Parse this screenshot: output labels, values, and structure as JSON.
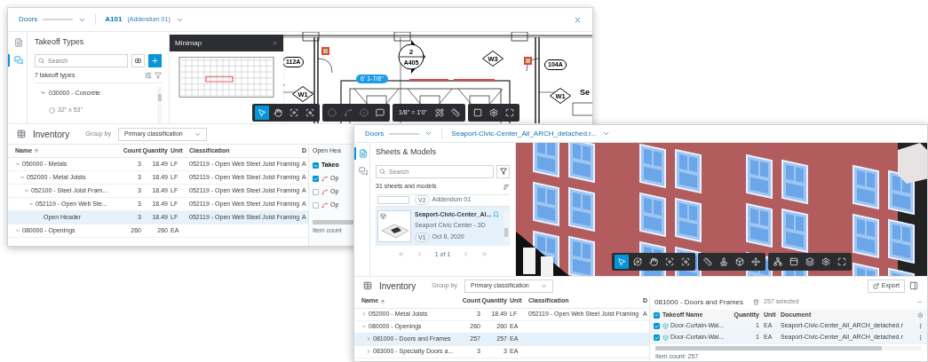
{
  "drawing_window": {
    "header": {
      "document_type": "Doors",
      "sheet": "A101",
      "sheet_version": "(Addendum 01)"
    },
    "rail": [
      {
        "kind": "sheets",
        "selected": false
      },
      {
        "kind": "takeoff",
        "selected": true
      }
    ],
    "takeoff_panel": {
      "title": "Takeoff Types",
      "search": {
        "placeholder": "Search"
      },
      "count_label": "7 takeoff types",
      "tree": [
        {
          "label": "030000 - Concrete",
          "expanded": true,
          "children": [
            {
              "label": "32\" x 53\""
            }
          ]
        }
      ]
    },
    "minimap": {
      "title": "Minimap"
    },
    "plan": {
      "door_tags": [
        "112A",
        "104A"
      ],
      "window_tags": [
        "W1",
        "W3",
        "W1"
      ],
      "section_marker": {
        "number": "2",
        "sheet": "A405"
      },
      "dimension": "6' 1-7/8\"",
      "room_label": "Se"
    },
    "toolbar": {
      "groups": [
        [
          {
            "kind": "select",
            "selected": true,
            "disabled": false
          },
          {
            "kind": "pan",
            "selected": false,
            "disabled": false
          },
          {
            "kind": "fit",
            "selected": false,
            "disabled": false
          },
          {
            "kind": "zoom-window",
            "selected": false,
            "disabled": false
          }
        ],
        [
          {
            "kind": "area",
            "selected": false,
            "disabled": true
          },
          {
            "kind": "linear",
            "selected": false,
            "disabled": true
          },
          {
            "kind": "count",
            "selected": false,
            "disabled": true
          },
          {
            "kind": "markup",
            "selected": false,
            "disabled": false
          }
        ],
        [
          {
            "kind": "scale",
            "label": "1/8\" = 1'0\"",
            "selected": false,
            "disabled": false
          },
          {
            "kind": "calibrate",
            "selected": false,
            "disabled": false
          },
          {
            "kind": "measure",
            "selected": false,
            "disabled": false
          }
        ],
        [
          {
            "kind": "layout",
            "selected": false,
            "disabled": false
          },
          {
            "kind": "settings",
            "selected": false,
            "disabled": false
          },
          {
            "kind": "fullscreen",
            "selected": false,
            "disabled": false
          }
        ]
      ]
    },
    "inventory": {
      "title": "Inventory",
      "group_by_label": "Group by",
      "group_by_value": "Primary classification",
      "columns": [
        "Name",
        "Count",
        "Quantity",
        "Unit",
        "Classification",
        "D"
      ],
      "rows": [
        {
          "name": "050000 - Metals",
          "count": "3",
          "quantity": "18.49",
          "unit": "LF",
          "classification": "052119 - Open Web Steel Joist Framing",
          "column_6": "A",
          "expanded": true,
          "selected": false,
          "children": [
            {
              "name": "052000 - Metal Joists",
              "count": "3",
              "quantity": "18.49",
              "unit": "LF",
              "classification": "052119 - Open Web Steel Joist Framing",
              "column_6": "A",
              "expanded": true,
              "selected": false,
              "children": [
                {
                  "name": "052100 - Steel Joist Fram...",
                  "count": "3",
                  "quantity": "18.49",
                  "unit": "LF",
                  "classification": "052119 - Open Web Steel Joist Framing",
                  "column_6": "A",
                  "expanded": true,
                  "selected": false,
                  "children": [
                    {
                      "name": "052119 - Open Web Ste...",
                      "count": "3",
                      "quantity": "18.49",
                      "unit": "LF",
                      "classification": "052119 - Open Web Steel Joist Framing",
                      "column_6": "A",
                      "expanded": true,
                      "selected": false,
                      "children": [
                        {
                          "name": "Open Header",
                          "count": "3",
                          "quantity": "18.49",
                          "unit": "LF",
                          "classification": "052119 - Open Web Steel Joist Framing",
                          "column_6": "A",
                          "selected": true
                        }
                      ]
                    }
                  ]
                }
              ]
            }
          ]
        },
        {
          "name": "080000 - Openings",
          "count": "260",
          "quantity": "260",
          "unit": "EA",
          "expanded": true,
          "selected": false
        }
      ],
      "detail_panel": {
        "title": "Open Hea",
        "header": {
          "label": "Takeo",
          "checked": true,
          "indeterminate": true
        },
        "rows": [
          {
            "label": "Op",
            "checked": true
          },
          {
            "label": "Op",
            "checked": false
          },
          {
            "label": "Op",
            "checked": false
          }
        ],
        "footer": "Item count"
      }
    }
  },
  "model_window": {
    "header": {
      "document_type": "Doors",
      "model": "Seaport-Civic-Center_All_ARCH_detached.r..."
    },
    "rail": [
      {
        "kind": "sheets",
        "selected": true
      },
      {
        "kind": "takeoff",
        "selected": false
      }
    ],
    "sheets_panel": {
      "title": "Sheets & Models",
      "search": {
        "placeholder": "Search"
      },
      "count_label": "31 sheets and models",
      "items": [
        {
          "kind": "cut",
          "version": "V2",
          "meta": "Addendum 01",
          "selected": false
        },
        {
          "kind": "model",
          "title": "Seaport-Civic-Center_Al...",
          "subtitle": "Seaport Civic Center - 3D",
          "version": "V1",
          "meta": "Oct 8, 2020",
          "selected": true
        }
      ],
      "pagination": "1 of 1"
    },
    "toolbar": {
      "groups": [
        [
          {
            "kind": "select",
            "selected": true,
            "disabled": false
          },
          {
            "kind": "orbit",
            "selected": false,
            "disabled": false
          },
          {
            "kind": "pan",
            "selected": false,
            "disabled": false
          },
          {
            "kind": "fit",
            "selected": false,
            "disabled": false
          },
          {
            "kind": "zoom-window",
            "selected": false,
            "disabled": false
          }
        ],
        [
          {
            "kind": "measure",
            "selected": false,
            "disabled": false
          },
          {
            "kind": "section",
            "selected": false,
            "disabled": false
          },
          {
            "kind": "cube",
            "selected": false,
            "disabled": false
          },
          {
            "kind": "explode",
            "selected": false,
            "disabled": false
          }
        ],
        [
          {
            "kind": "tree",
            "selected": false,
            "disabled": false
          },
          {
            "kind": "properties",
            "selected": false,
            "disabled": false
          },
          {
            "kind": "layers",
            "selected": false,
            "disabled": false
          },
          {
            "kind": "settings",
            "selected": false,
            "disabled": false
          },
          {
            "kind": "fullscreen",
            "selected": false,
            "disabled": false
          }
        ]
      ]
    },
    "inventory": {
      "title": "Inventory",
      "group_by_label": "Group by",
      "group_by_value": "Primary classification",
      "export": "Export",
      "columns": [
        "Name",
        "Count",
        "Quantity",
        "Unit",
        "Classification",
        "D"
      ],
      "rows": [
        {
          "name": "052000 - Metal Joists",
          "count": "3",
          "quantity": "18.49",
          "unit": "LF",
          "classification": "052119 - Open Web Steel Joist Framing",
          "column_6": "A",
          "expanded": false,
          "selected": false
        },
        {
          "name": "080000 - Openings",
          "count": "260",
          "quantity": "260",
          "unit": "EA",
          "expanded": true,
          "selected": false,
          "children": [
            {
              "name": "081000 - Doors and Frames",
              "count": "257",
              "quantity": "257",
              "unit": "EA",
              "expanded": false,
              "selected": true
            },
            {
              "name": "083000 - Specialty Doors a...",
              "count": "3",
              "quantity": "3",
              "unit": "EA",
              "expanded": false,
              "selected": false
            }
          ]
        }
      ],
      "detail_panel": {
        "title": "081000 - Doors and Frames",
        "selection": "257 selected",
        "all_checked": true,
        "columns": [
          "Takeoff Name",
          "Quantity",
          "Unit",
          "Document"
        ],
        "rows": [
          {
            "name": "Door-Curtain-Wal...",
            "quantity": "1",
            "unit": "EA",
            "document": "Seaport-Civic-Center_All_ARCH_detached.r",
            "checked": true
          },
          {
            "name": "Door-Curtain-Wal...",
            "quantity": "1",
            "unit": "EA",
            "document": "Seaport-Civic-Center_All_ARCH_detached.r",
            "checked": true
          }
        ],
        "footer": "Item count: 257"
      }
    }
  }
}
